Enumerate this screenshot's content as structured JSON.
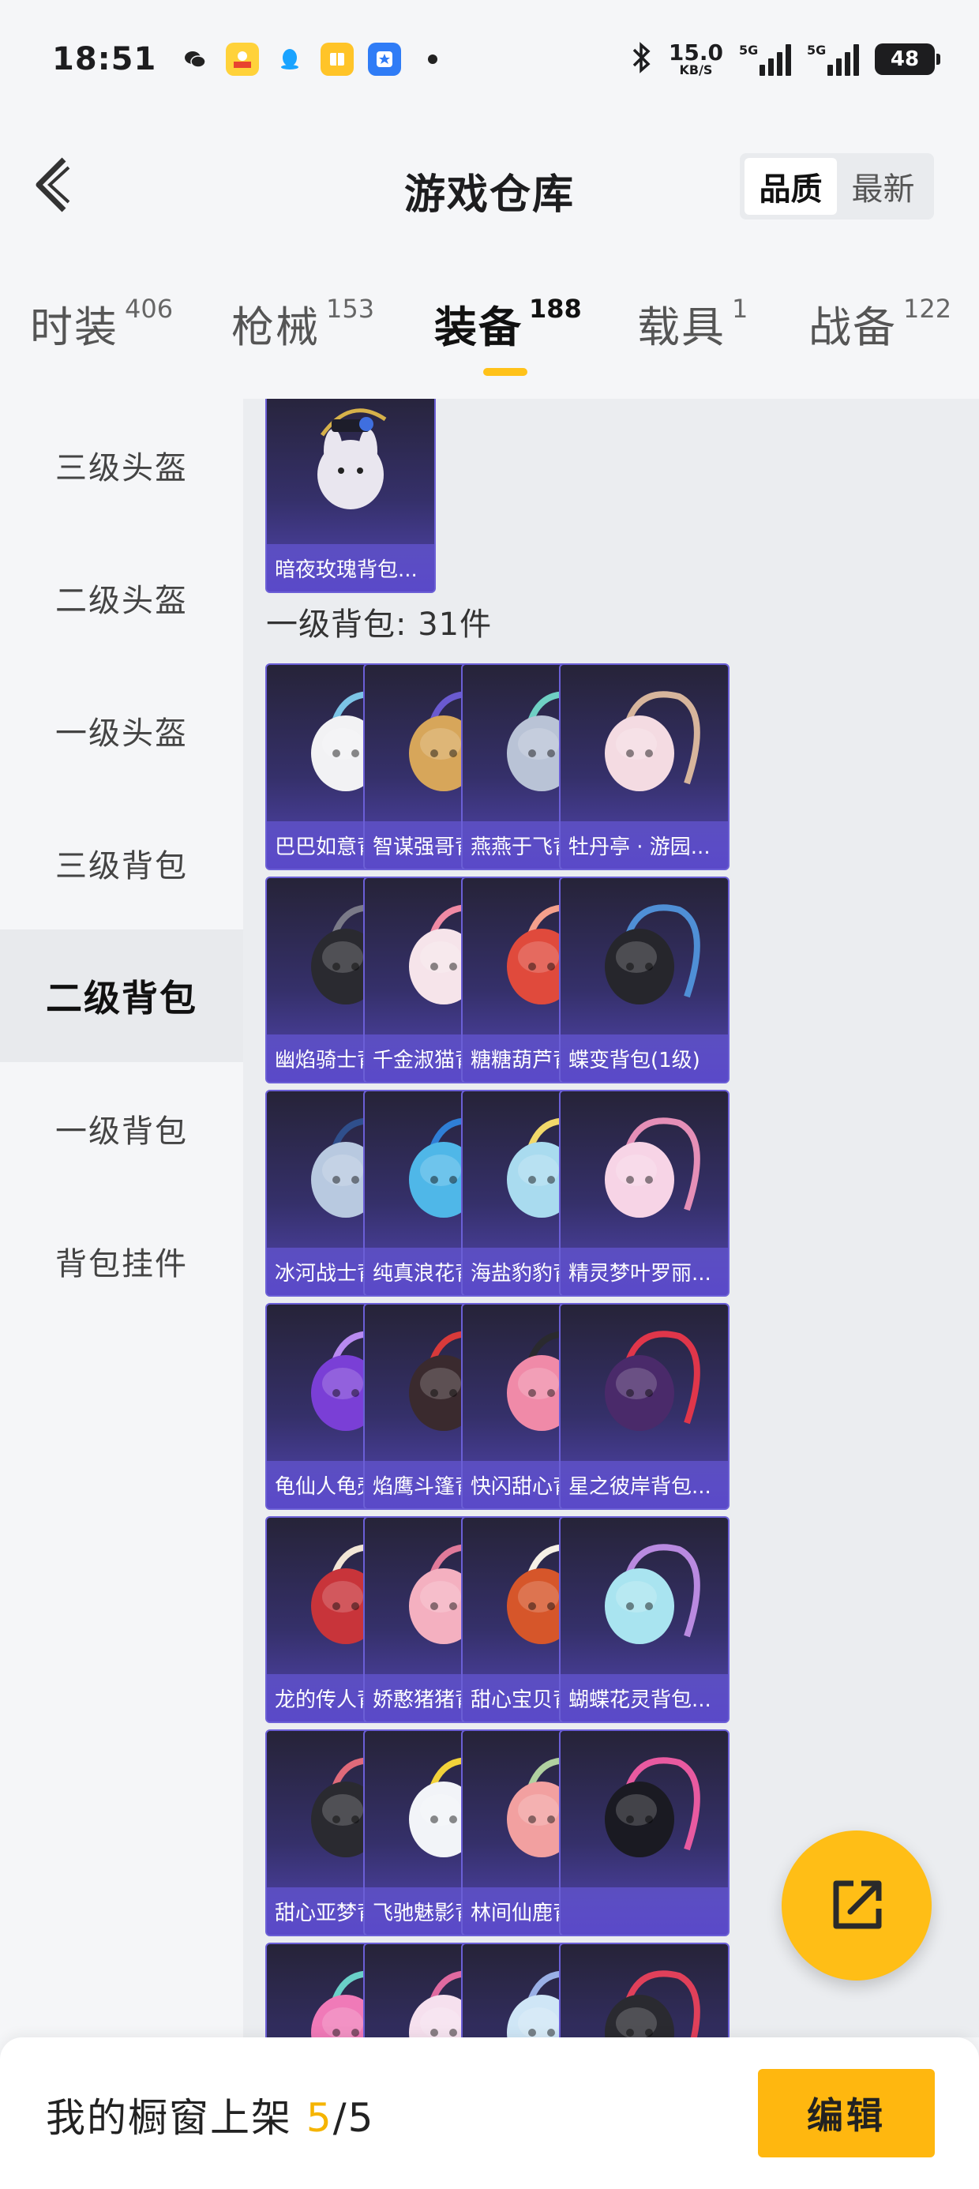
{
  "status_bar": {
    "time": "18:51",
    "net_speed_value": "15.0",
    "net_speed_unit": "KB/S",
    "signal_1_label": "5G",
    "signal_2_label": "5G",
    "battery": "48",
    "app_icons": [
      "wechat-icon",
      "coupon-app-icon",
      "qq-icon",
      "reader-app-icon",
      "store-app-icon"
    ]
  },
  "header": {
    "title": "游戏仓库",
    "sort_options": [
      {
        "label": "品质",
        "active": true
      },
      {
        "label": "最新",
        "active": false
      }
    ]
  },
  "tabs": [
    {
      "label": "时装",
      "count": "406",
      "active": false
    },
    {
      "label": "枪械",
      "count": "153",
      "active": false
    },
    {
      "label": "装备",
      "count": "188",
      "active": true
    },
    {
      "label": "载具",
      "count": "1",
      "active": false
    },
    {
      "label": "战备",
      "count": "122",
      "active": false
    }
  ],
  "sidebar": [
    {
      "label": "三级头盔",
      "active": false
    },
    {
      "label": "二级头盔",
      "active": false
    },
    {
      "label": "一级头盔",
      "active": false
    },
    {
      "label": "三级背包",
      "active": false
    },
    {
      "label": "二级背包",
      "active": true
    },
    {
      "label": "一级背包",
      "active": false
    },
    {
      "label": "背包挂件",
      "active": false
    }
  ],
  "top_item": {
    "name": "暗夜玫瑰背包..."
  },
  "section": {
    "heading": "一级背包: 31件"
  },
  "items": [
    {
      "name": "巴巴如意背包..."
    },
    {
      "name": "智谋强哥背包..."
    },
    {
      "name": "燕燕于飞背包..."
    },
    {
      "name": "牡丹亭 · 游园..."
    },
    {
      "name": "幽焰骑士背包..."
    },
    {
      "name": "千金淑猫背包..."
    },
    {
      "name": "糖糖葫芦背包..."
    },
    {
      "name": "蝶变背包(1级)"
    },
    {
      "name": "冰河战士背包..."
    },
    {
      "name": "纯真浪花背包..."
    },
    {
      "name": "海盐豹豹背包..."
    },
    {
      "name": "精灵梦叶罗丽..."
    },
    {
      "name": "龟仙人龟壳背..."
    },
    {
      "name": "焰鹰斗篷背包..."
    },
    {
      "name": "快闪甜心背包..."
    },
    {
      "name": "星之彼岸背包..."
    },
    {
      "name": "龙的传人背包..."
    },
    {
      "name": "娇憨猪猪背包..."
    },
    {
      "name": "甜心宝贝背包..."
    },
    {
      "name": "蝴蝶花灵背包..."
    },
    {
      "name": "甜心亚梦背包..."
    },
    {
      "name": "飞驰魅影背包..."
    },
    {
      "name": "林间仙鹿背包..."
    },
    {
      "name": ""
    },
    {
      "name": ""
    },
    {
      "name": ""
    },
    {
      "name": ""
    },
    {
      "name": ""
    }
  ],
  "bottom_bar": {
    "shelf_label": "我的橱窗上架",
    "shelf_current": "5",
    "shelf_separator": "/",
    "shelf_total": "5",
    "edit_label": "编辑"
  },
  "colors": {
    "accent": "#ffc21a",
    "card_top": "#262338",
    "card_bottom": "#5346b4",
    "card_border": "#6b5fd6"
  }
}
